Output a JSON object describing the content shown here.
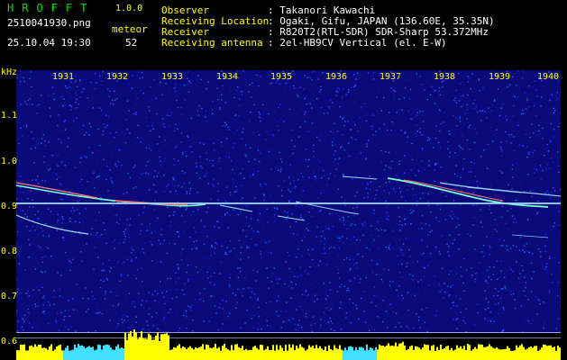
{
  "header": {
    "logo": "HROFFT",
    "version": "1.0.0",
    "filename": "2510041930.png",
    "datetime": "25.10.04 19:30",
    "meteor_label": "meteor",
    "meteor_count": "52",
    "info": [
      {
        "label": "Observer",
        "value": ": Takanori Kawachi"
      },
      {
        "label": "Receiving Location",
        "value": ": Ogaki, Gifu, JAPAN (136.60E, 35.35N)"
      },
      {
        "label": "Receiver",
        "value": ": R820T2(RTL-SDR) SDR-Sharp 53.372MHz"
      },
      {
        "label": "Receiving antenna",
        "value": ": 2el-HB9CV Vertical (el. E-W)"
      }
    ]
  },
  "axis": {
    "y_unit": "kHz",
    "y_ticks": [
      "1.1",
      "1.0",
      "0.9",
      "0.8",
      "0.7",
      "0.6"
    ],
    "x_ticks": [
      "1931",
      "1932",
      "1933",
      "1934",
      "1935",
      "1936",
      "1937",
      "1938",
      "1939",
      "1940"
    ]
  },
  "colors": {
    "background": "#000000",
    "plot_bg": "#0a0a7a",
    "axis_text": "#ffff00",
    "logo": "#00e000",
    "carrier_line": "#9ad8ff",
    "meteor": "#7fffd4",
    "bottom_bar": "#ffff00"
  }
}
